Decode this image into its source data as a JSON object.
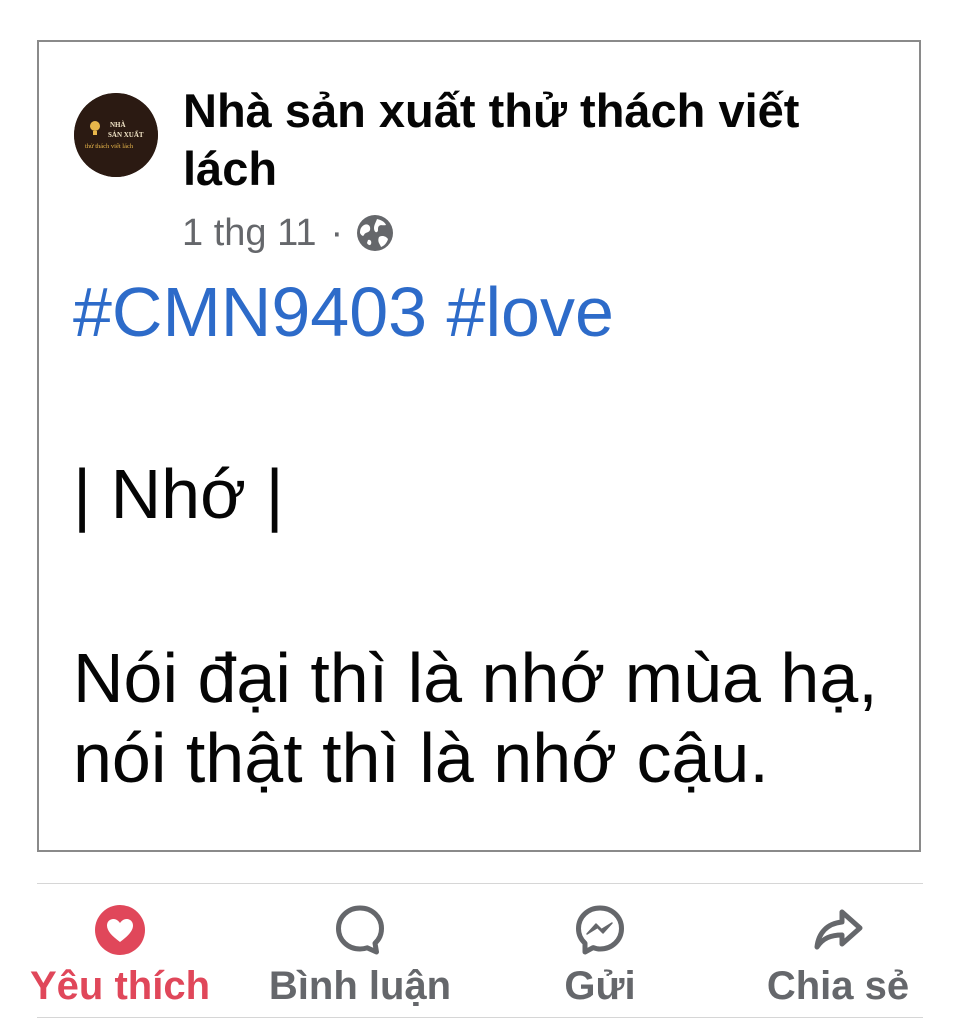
{
  "post": {
    "author_name": "Nhà sản xuất thử thách viết lách",
    "avatar": {
      "line1": "NHÀ",
      "line2": "SẢN XUẤT",
      "line3": "thử thách viết lách"
    },
    "timestamp": "1 thg 11",
    "separator": "·",
    "privacy_icon": "globe-icon",
    "hashtags": [
      "#CMN9403",
      "#love"
    ],
    "title": "| Nhớ |",
    "body_lines": [
      "Nói đại thì là nhớ mùa hạ,",
      "nói thật thì là nhớ cậu."
    ]
  },
  "actions": {
    "like": {
      "label": "Yêu thích",
      "icon": "heart-icon",
      "active": true,
      "color": "#e0475a"
    },
    "comment": {
      "label": "Bình luận",
      "icon": "comment-icon"
    },
    "send": {
      "label": "Gửi",
      "icon": "messenger-icon"
    },
    "share": {
      "label": "Chia sẻ",
      "icon": "share-icon"
    }
  },
  "colors": {
    "hashtag": "#2d6bc9",
    "secondary_text": "#65676b",
    "like_active": "#e0475a",
    "avatar_bg": "#2b1a12"
  }
}
